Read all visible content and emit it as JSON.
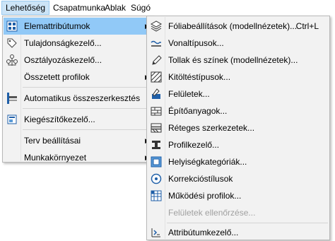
{
  "menubar": {
    "items": [
      "Lehetőség",
      "Csapatmunka",
      "Ablak",
      "Súgó"
    ]
  },
  "menu_lehetoseg": {
    "items": [
      {
        "label": "Elemattribútumok",
        "icon": "element-attributes-icon",
        "submenu": true,
        "highlighted": true
      },
      {
        "label": "Tulajdonságkezelő...",
        "icon": "property-tag-icon"
      },
      {
        "label": "Osztályozáskezelő...",
        "icon": "classification-tree-icon"
      },
      {
        "label": "Összetett profilok",
        "icon": "",
        "submenu": true
      },
      {
        "label": "Automatikus összeszerkesztés",
        "icon": "auto-intersection-icon"
      },
      {
        "label": "Kiegészítőkezelő...",
        "icon": "addon-manager-icon"
      },
      {
        "label": "Terv beállításai",
        "icon": "",
        "submenu": true
      },
      {
        "label": "Munkakörnyezet",
        "icon": "",
        "submenu": true
      }
    ]
  },
  "submenu_elemattributumok": {
    "items": [
      {
        "label": "Fóliabeállítások (modellnézetek)...",
        "shortcut": "Ctrl+L",
        "icon": "layer-settings-icon"
      },
      {
        "label": "Vonaltípusok...",
        "icon": "line-types-icon"
      },
      {
        "label": "Tollak és színek (modellnézetek)...",
        "icon": "pens-colors-icon"
      },
      {
        "label": "Kitöltéstípusok...",
        "icon": "fill-types-icon"
      },
      {
        "label": "Felületek...",
        "icon": "surfaces-icon"
      },
      {
        "label": "Építőanyagok...",
        "icon": "building-materials-icon"
      },
      {
        "label": "Réteges szerkezetek...",
        "icon": "composites-icon"
      },
      {
        "label": "Profilkezelő...",
        "icon": "profile-manager-icon"
      },
      {
        "label": "Helyiségkategóriák...",
        "icon": "zone-categories-icon"
      },
      {
        "label": "Korrekcióstílusok",
        "icon": "markup-styles-icon"
      },
      {
        "label": "Működési profilok...",
        "icon": "operation-profiles-icon"
      },
      {
        "label": "Felületek ellenőrzése...",
        "icon": "",
        "disabled": true
      },
      {
        "label": "Attribútumkezelő...",
        "icon": "attribute-manager-icon"
      }
    ]
  }
}
